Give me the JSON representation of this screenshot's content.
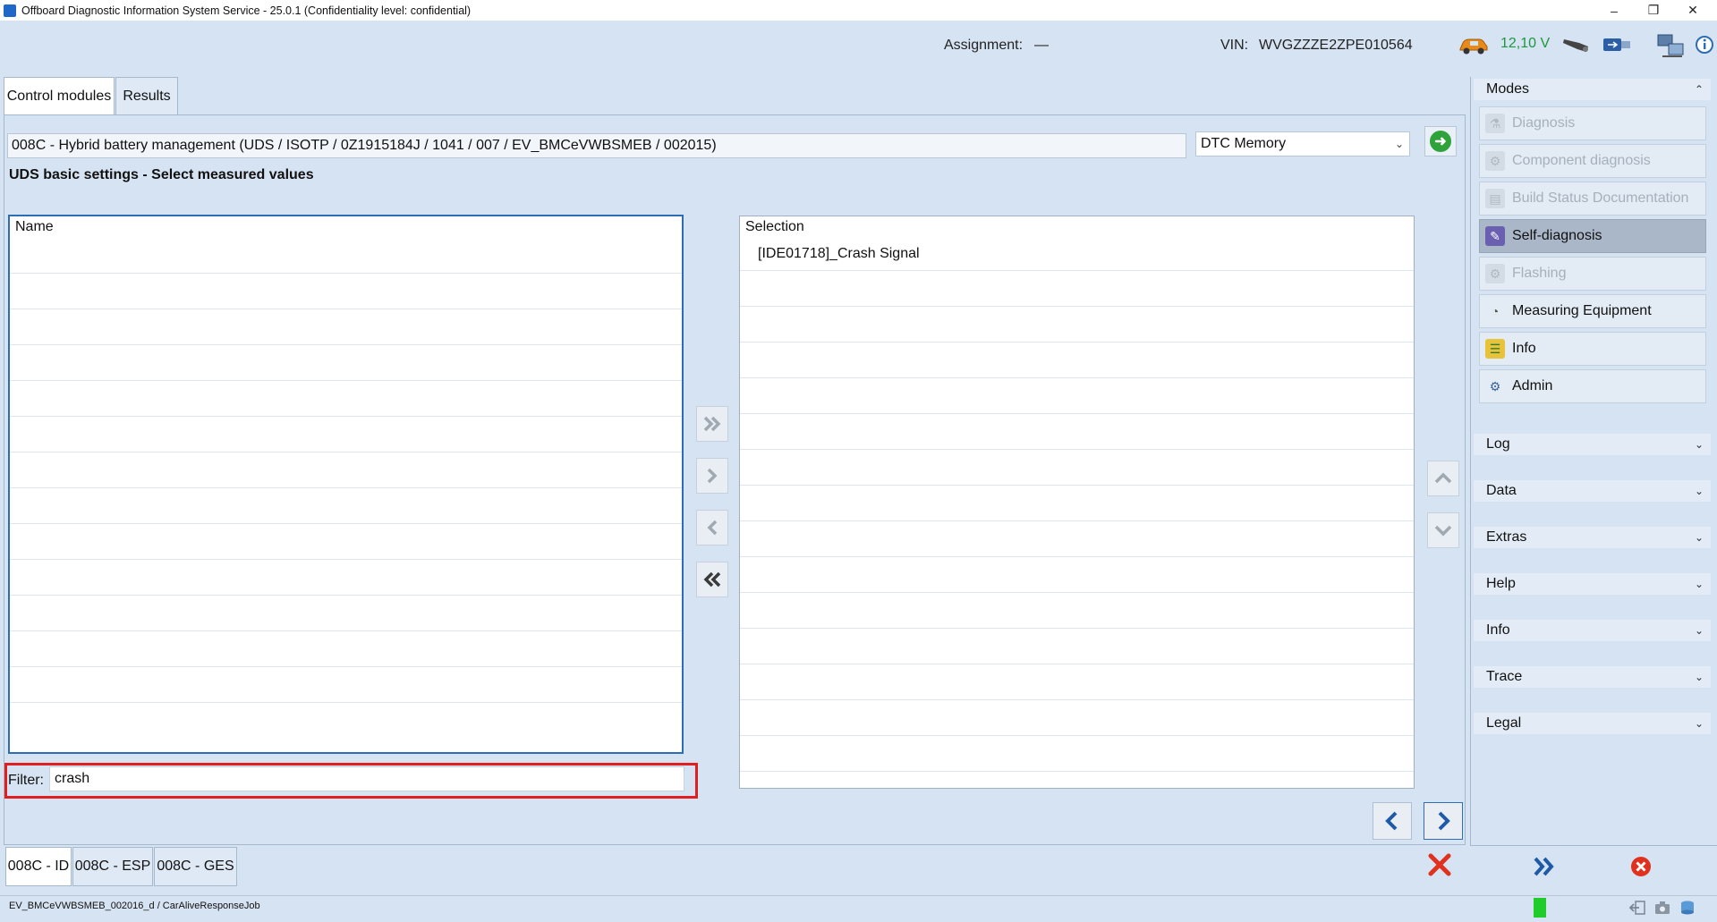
{
  "window": {
    "title": "Offboard Diagnostic Information System Service - 25.0.1 (Confidentiality level: confidential)",
    "minimize": "–",
    "maximize": "❐",
    "close": "✕"
  },
  "header": {
    "assignment_label": "Assignment:",
    "assignment_value": "—",
    "vin_label": "VIN:",
    "vin_value": "WVGZZZE2ZPE010564",
    "voltage": "12,10 V"
  },
  "tabs": [
    {
      "label": "Control modules",
      "active": true
    },
    {
      "label": "Results",
      "active": false
    }
  ],
  "module": {
    "description": "008C - Hybrid battery management  (UDS / ISOTP / 0Z1915184J / 1041 / 007 / EV_BMCeVWBSMEB / 002015)",
    "dtc_select": "DTC Memory"
  },
  "page_title": "UDS basic settings - Select measured values",
  "name_list": {
    "header": "Name",
    "items": []
  },
  "selection_list": {
    "header": "Selection",
    "items": [
      "[IDE01718]_Crash Signal"
    ]
  },
  "filter": {
    "label": "Filter:",
    "value": "crash"
  },
  "bottom_tabs": [
    {
      "label": "008C - ID",
      "active": true
    },
    {
      "label": "008C - ESP",
      "active": false
    },
    {
      "label": "008C - GES",
      "active": false
    }
  ],
  "modes": {
    "header": "Modes",
    "items": [
      {
        "label": "Diagnosis",
        "state": "disabled",
        "icon": "stethoscope-icon"
      },
      {
        "label": "Component diagnosis",
        "state": "disabled",
        "icon": "car-icon"
      },
      {
        "label": "Build Status Documentation",
        "state": "disabled",
        "icon": "document-icon"
      },
      {
        "label": "Self-diagnosis",
        "state": "active",
        "icon": "self-diagnosis-icon"
      },
      {
        "label": "Flashing",
        "state": "disabled",
        "icon": "flash-icon"
      },
      {
        "label": "Measuring Equipment",
        "state": "normal",
        "icon": "gauge-icon"
      },
      {
        "label": "Info",
        "state": "normal",
        "icon": "books-icon"
      },
      {
        "label": "Admin",
        "state": "normal",
        "icon": "admin-gear-icon"
      }
    ]
  },
  "sections": [
    "Log",
    "Data",
    "Extras",
    "Help",
    "Info",
    "Trace",
    "Legal"
  ],
  "statusbar": {
    "text": "EV_BMCeVWBSMEB_002016_d / CarAliveResponseJob"
  },
  "colors": {
    "background": "#d6e3f2",
    "accent_blue": "#2d6db5",
    "highlight_red": "#e02020",
    "status_green": "#1fcc2a",
    "voltage_green": "#1a9a3a"
  }
}
